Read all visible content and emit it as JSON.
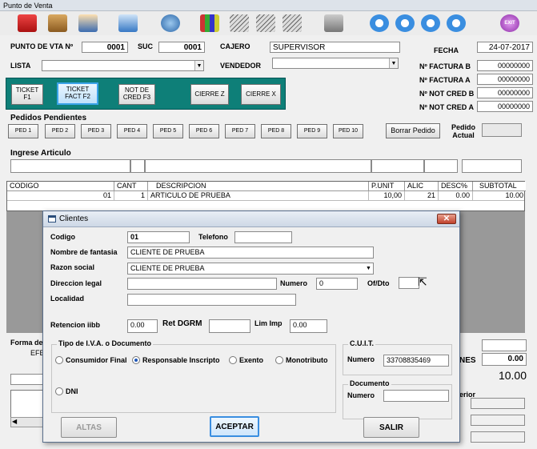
{
  "window": {
    "title": "Punto de Venta"
  },
  "toolbar": {
    "icons": [
      "cash-register-icon",
      "boxes-icon",
      "cashier-icon",
      "refresh-icon",
      "dollar-icon",
      "chart-icon",
      "notes-icon",
      "notes-2-icon",
      "notes-3-icon",
      "drive-icon",
      "gear-1-icon",
      "gear-2-icon",
      "gear-3-icon",
      "gear-4-icon",
      "exit-icon"
    ],
    "exit_label": "EXIT"
  },
  "header": {
    "punto_label": "PUNTO DE VTA Nº",
    "punto_value": "0001",
    "suc_label": "SUC",
    "suc_value": "0001",
    "cajero_label": "CAJERO",
    "cajero_value": "SUPERVISOR",
    "fecha_label": "FECHA",
    "fecha_value": "24-07-2017",
    "lista_label": "LISTA",
    "lista_value": "",
    "vendedor_label": "VENDEDOR",
    "vendedor_value": ""
  },
  "invoices": [
    {
      "label": "Nº FACTURA B",
      "value": "00000000"
    },
    {
      "label": "Nº FACTURA A",
      "value": "00000000"
    },
    {
      "label": "Nº NOT CRED B",
      "value": "00000000"
    },
    {
      "label": "Nº NOT CRED A",
      "value": "00000000"
    }
  ],
  "function_buttons": {
    "ticket_f1": "TICKET F1",
    "ticket_fact": "TICKET FACT F2",
    "not_cred": "NOT DE CRED F3",
    "cierre_z": "CIERRE Z",
    "cierre_x": "CIERRE X"
  },
  "pedidos": {
    "title": "Pedidos Pendientes",
    "buttons": [
      "PED 1",
      "PED 2",
      "PED 3",
      "PED 4",
      "PED 5",
      "PED 6",
      "PED 7",
      "PED 8",
      "PED 9",
      "PED 10"
    ],
    "borrar": "Borrar Pedido",
    "actual_label": "Pedido Actual",
    "actual_value": ""
  },
  "articulo": {
    "label": "Ingrese Articulo"
  },
  "grid": {
    "headers": [
      "CODIGO",
      "CANT",
      "DESCRIPCION",
      "P.UNIT",
      "ALIC",
      "DESC%",
      "SUBTOTAL"
    ],
    "row": [
      "01",
      "1",
      "ARTICULO DE PRUEBA",
      "10,00",
      "21",
      "0.00",
      "10.00"
    ]
  },
  "behind": {
    "forma_label": "Forma de",
    "efe_label": "EFE",
    "nes_label": "NES",
    "nes_value": "0.00",
    "total_value": "10.00",
    "erior_label": "erior"
  },
  "dialog": {
    "title": "Clientes",
    "codigo_label": "Codigo",
    "codigo_value": "01",
    "telefono_label": "Telefono",
    "telefono_value": "",
    "fantasia_label": "Nombre de fantasia",
    "fantasia_value": "CLIENTE DE PRUEBA",
    "razon_label": "Razon social",
    "razon_value": "CLIENTE DE PRUEBA",
    "direccion_label": "Direccion legal",
    "direccion_value": "",
    "numero_label": "Numero",
    "numero_value": "0",
    "ofdto_label": "Of/Dto",
    "ofdto_value": "",
    "localidad_label": "Localidad",
    "localidad_value": "",
    "retencion_label": "Retencion iibb",
    "retencion_value": "0.00",
    "dgrm_label": "Ret DGRM",
    "dgrm_value": "",
    "limimp_label": "Lim Imp",
    "limimp_value": "0.00",
    "iva_title": "Tipo de I.V.A. o Documento",
    "iva_options": [
      "Consumidor Final",
      "Responsable Inscripto",
      "Exento",
      "Monotributo",
      "DNI"
    ],
    "iva_selected": "Responsable Inscripto",
    "cuit_title": "C.U.I.T.",
    "cuit_numero_label": "Numero",
    "cuit_value": "33708835469",
    "documento_title": "Documento",
    "documento_numero_label": "Numero",
    "documento_value": "",
    "altas": "ALTAS",
    "aceptar": "ACEPTAR",
    "salir": "SALIR"
  }
}
